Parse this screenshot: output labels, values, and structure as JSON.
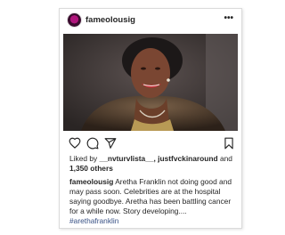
{
  "post": {
    "username": "fameolousig",
    "more_label": "•••",
    "likes_prefix": "Liked by ",
    "likes_names": "__nvturvlista__, justfvckinaround",
    "likes_joiner": " and ",
    "likes_count": "1,350 others",
    "caption_text": " Aretha Franklin not doing good and may pass soon. Celebrities are at the hospital saying goodbye. Aretha has been battling cancer for a while now. Story developing....",
    "hashtag": "#arethafranklin"
  },
  "icons": {
    "like": "heart-icon",
    "comment": "comment-icon",
    "share": "send-icon",
    "save": "bookmark-icon",
    "more": "more-dots-icon"
  },
  "colors": {
    "text": "#262626",
    "hashtag": "#385185",
    "border": "#dbdbdb",
    "avatar_accent": "#b0157c"
  }
}
